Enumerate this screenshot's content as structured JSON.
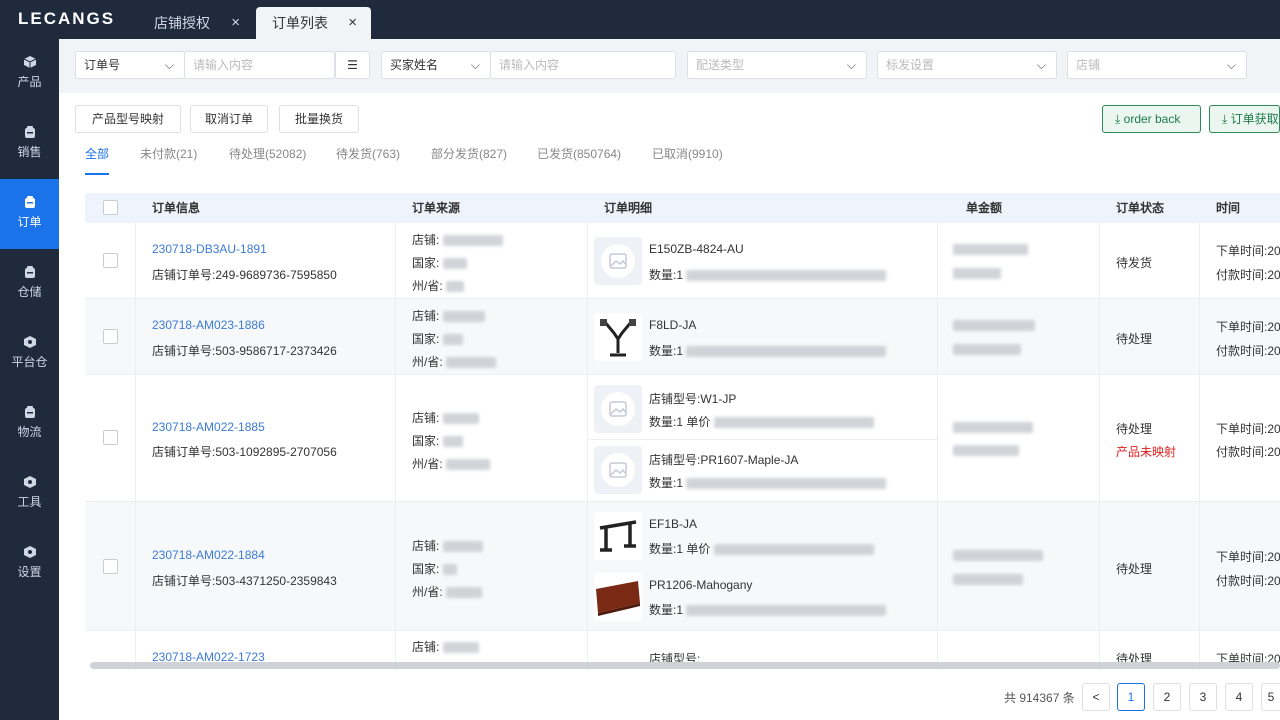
{
  "app": {
    "logo": "LECANGS"
  },
  "tabs": [
    {
      "label": "店铺授权",
      "close": "×"
    },
    {
      "label": "订单列表",
      "close": "×"
    }
  ],
  "sidebar": {
    "items": [
      {
        "label": "产品"
      },
      {
        "label": "销售"
      },
      {
        "label": "订单"
      },
      {
        "label": "仓储"
      },
      {
        "label": "平台仓"
      },
      {
        "label": "物流"
      },
      {
        "label": "工具"
      },
      {
        "label": "设置"
      }
    ]
  },
  "filters": {
    "order_field": "订单号",
    "order_input_placeholder": "请输入内容",
    "buyer_field": "买家姓名",
    "buyer_input_placeholder": "请输入内容",
    "delivery_type": "配送类型",
    "label_setting": "标发设置",
    "shop": "店铺"
  },
  "actions": {
    "map_model": "产品型号映射",
    "cancel_order": "取消订单",
    "batch_swap": "批量换货",
    "order_back": "order back",
    "fetch_orders": "订单获取"
  },
  "status_tabs": [
    "全部",
    "未付款(21)",
    "待处理(52082)",
    "待发货(763)",
    "部分发货(827)",
    "已发货(850764)",
    "已取消(9910)"
  ],
  "table": {
    "headers": [
      "订单信息",
      "订单来源",
      "订单明细",
      "单金额",
      "订单状态",
      "时间"
    ],
    "labels": {
      "shop": "店铺:",
      "country": "国家:",
      "state": "州/省:",
      "qty": "数量:1",
      "unit_price": "单价",
      "order_time": "下单时间:20",
      "pay_time": "付款时间:20"
    },
    "rows": [
      {
        "order_no": "230718-DB3AU-1891",
        "shop_order": "店铺订单号:249-9689736-7595850",
        "items": [
          {
            "code": "E150ZB-4824-AU"
          }
        ],
        "status": "待发货"
      },
      {
        "order_no": "230718-AM023-1886",
        "shop_order": "店铺订单号:503-9586717-2373426",
        "items": [
          {
            "code": "F8LD-JA"
          }
        ],
        "status": "待处理"
      },
      {
        "order_no": "230718-AM022-1885",
        "shop_order": "店铺订单号:503-1092895-2707056",
        "items": [
          {
            "code": "店铺型号:W1-JP"
          },
          {
            "code": "店铺型号:PR1607-Maple-JA"
          }
        ],
        "status": "待处理",
        "status_warning": "产品未映射"
      },
      {
        "order_no": "230718-AM022-1884",
        "shop_order": "店铺订单号:503-4371250-2359843",
        "items": [
          {
            "code": "EF1B-JA"
          },
          {
            "code": "PR1206-Mahogany"
          }
        ],
        "status": "待处理"
      },
      {
        "order_no": "230718-AM022-1723",
        "items": [
          {
            "code": "店铺型号:"
          }
        ],
        "status": "待处理"
      }
    ]
  },
  "pagination": {
    "total": "共 914367 条",
    "prev": "<",
    "pages": [
      "1",
      "2",
      "3",
      "4",
      "5"
    ],
    "current": "1"
  },
  "colors": {
    "sidebar_bg": "#1f2a3d",
    "accent": "#1a73e8",
    "link": "#3b7bd6",
    "success_border": "#2e8b57",
    "warning_red": "#e02020"
  }
}
